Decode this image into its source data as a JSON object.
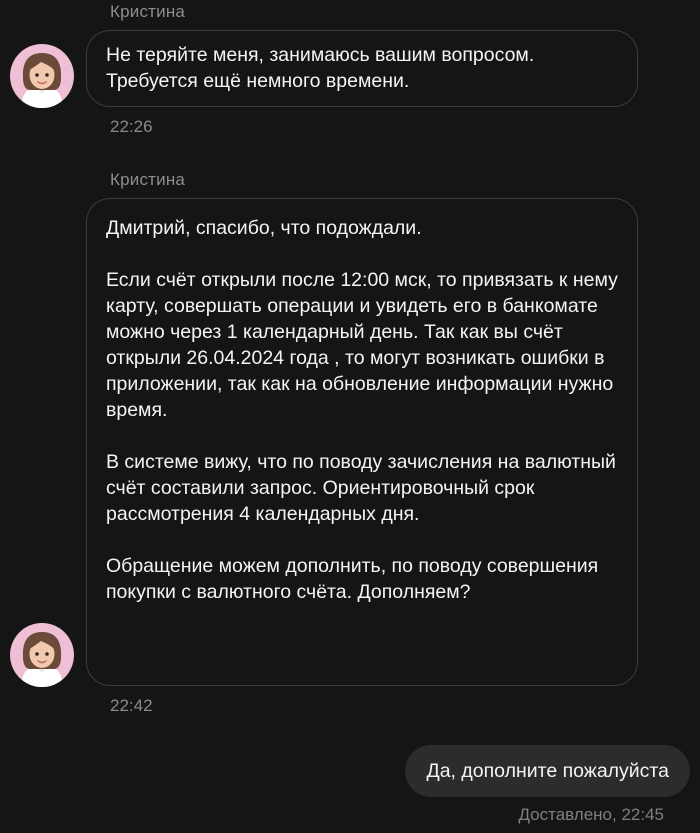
{
  "colors": {
    "background": "#151515",
    "incoming_bubble_border": "#3c3c3c",
    "outgoing_bubble": "#2c2c2c",
    "meta_text": "#8a8a8a",
    "avatar_background": "#efbfd6"
  },
  "messages": [
    {
      "sender": "Кристина",
      "avatar_icon": "operator-avatar-icon",
      "paragraphs": [
        "Не теряйте меня, занимаюсь вашим вопросом. Требуется ещё немного времени."
      ],
      "time": "22:26"
    },
    {
      "sender": "Кристина",
      "avatar_icon": "operator-avatar-icon",
      "paragraphs": [
        "Дмитрий, спасибо, что подождали.",
        "Если счёт открыли после 12:00 мск, то привязать к нему карту, совершать операции и увидеть его в банкомате можно через 1 календарный день. Так как вы счёт открыли 26.04.2024 года , то могут возникать ошибки в приложении, так как на обновление информации нужно время.",
        "В системе вижу, что по поводу зачисления на валютный счёт составили запрос. Ориентировочный срок рассмотрения 4 календарных дня.",
        "Обращение можем дополнить, по поводу совершения покупки с валютного счёта. Дополняем?"
      ],
      "time": "22:42"
    }
  ],
  "outgoing": {
    "text": "Да, дополните пожалуйста",
    "status": "Доставлено, 22:45"
  }
}
